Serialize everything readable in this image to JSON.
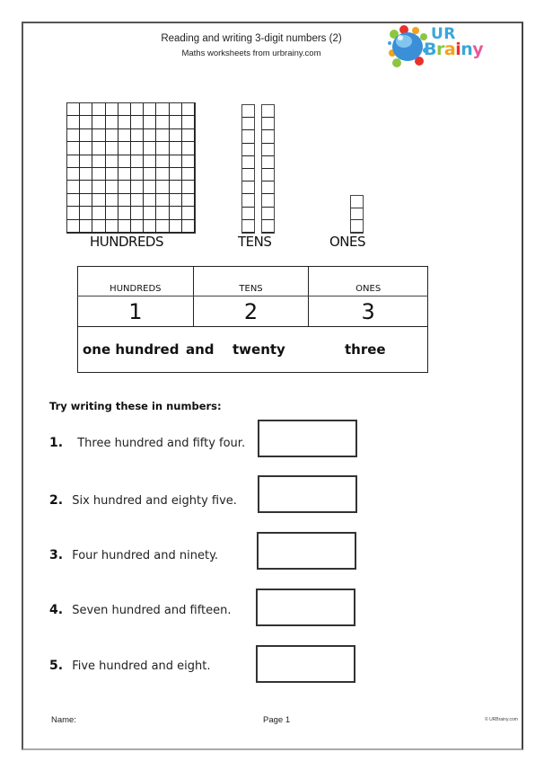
{
  "header": {
    "title": "Reading and writing 3-digit numbers (2)",
    "subtitle": "Maths worksheets from urbrainy.com",
    "logo": {
      "icon": "brain-globe-logo-icon",
      "text_top": "UR",
      "text_bottom_letters": [
        {
          "ch": "B",
          "color": "#3aa6dc"
        },
        {
          "ch": "r",
          "color": "#8cc63f"
        },
        {
          "ch": "a",
          "color": "#f2a31b"
        },
        {
          "ch": "i",
          "color": "#e8322c"
        },
        {
          "ch": "n",
          "color": "#3aa6dc"
        },
        {
          "ch": "y",
          "color": "#e85a9a"
        }
      ]
    }
  },
  "blocks": {
    "hundreds_label": "HUNDREDS",
    "tens_label": "TENS",
    "ones_label": "ONES",
    "hundreds_count": 1,
    "tens_count": 2,
    "ones_count": 3
  },
  "place_value_table": {
    "headers": [
      "HUNDREDS",
      "TENS",
      "ONES"
    ],
    "digits": [
      "1",
      "2",
      "3"
    ],
    "words": [
      "one hundred",
      "and",
      "twenty",
      "three"
    ]
  },
  "exercise": {
    "heading": "Try writing these in numbers:",
    "questions": [
      {
        "num": "1.",
        "text": "Three hundred and fifty four.",
        "answer": ""
      },
      {
        "num": "2.",
        "text": "Six hundred and eighty five.",
        "answer": ""
      },
      {
        "num": "3.",
        "text": "Four hundred and ninety.",
        "answer": ""
      },
      {
        "num": "4.",
        "text": "Seven hundred and fifteen.",
        "answer": ""
      },
      {
        "num": "5.",
        "text": "Five hundred and eight.",
        "answer": ""
      }
    ]
  },
  "footer": {
    "name_label": "Name:",
    "page_label": "Page 1",
    "copyright": "© URBrainy.com"
  }
}
